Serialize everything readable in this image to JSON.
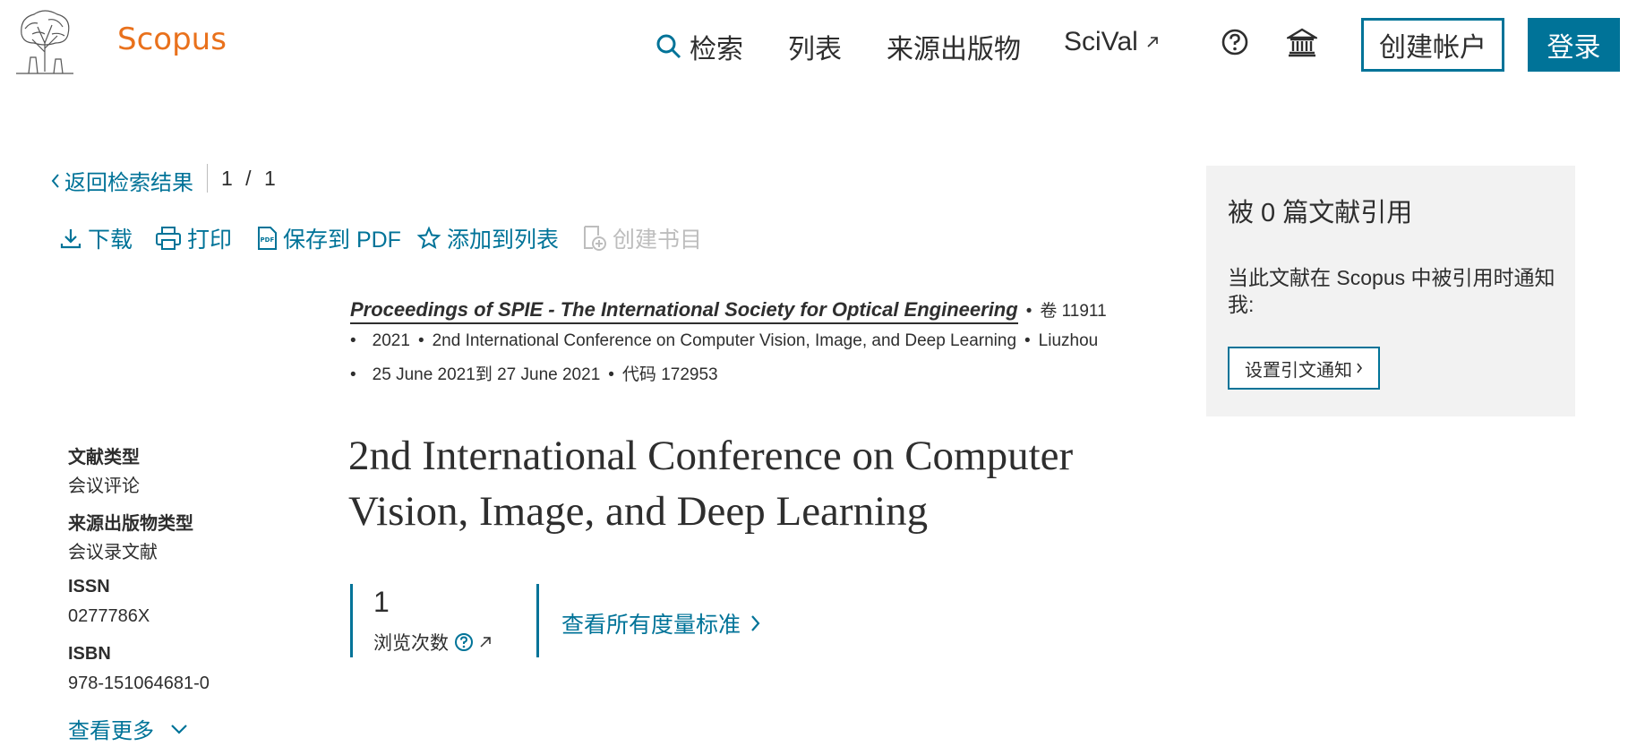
{
  "header": {
    "brand": "Scopus",
    "nav": [
      {
        "label": "检索",
        "icon": "search-icon"
      },
      {
        "label": "列表"
      },
      {
        "label": "来源出版物"
      },
      {
        "label": "SciVal",
        "icon": "external-link-icon"
      }
    ],
    "help_icon": "help-icon",
    "institution_icon": "institution-icon",
    "create_account": "创建帐户",
    "login": "登录"
  },
  "back": {
    "label": "返回检索结果",
    "pager": "1 / 1"
  },
  "toolbar": {
    "download": "下载",
    "print": "打印",
    "save_pdf": "保存到 PDF",
    "add_list": "添加到列表",
    "create_bib": "创建书目"
  },
  "source": {
    "journal": "Proceedings of SPIE - The International Society for Optical Engineering",
    "volume": "卷 11911",
    "year": "2021",
    "conference": "2nd International Conference on Computer Vision, Image, and Deep Learning",
    "location": "Liuzhou",
    "dates": "25 June 2021到 27 June 2021",
    "code": "代码 172953"
  },
  "title": "2nd International Conference on Computer Vision, Image, and Deep Learning",
  "metrics": {
    "views_value": "1",
    "views_label": "浏览次数",
    "view_all": "查看所有度量标准"
  },
  "meta": {
    "doc_type_label": "文献类型",
    "doc_type_value": "会议评论",
    "source_type_label": "来源出版物类型",
    "source_type_value": "会议录文献",
    "issn_label": "ISSN",
    "issn_value": "0277786X",
    "isbn_label": "ISBN",
    "isbn_value": "978-151064681-0",
    "show_more": "查看更多"
  },
  "citations": {
    "heading": "被 0 篇文献引用",
    "text": "当此文献在 Scopus 中被引用时通知我:",
    "button": "设置引文通知"
  },
  "colors": {
    "accent": "#007398",
    "brand": "#e9711c",
    "panel_bg": "#f2f2f2"
  }
}
